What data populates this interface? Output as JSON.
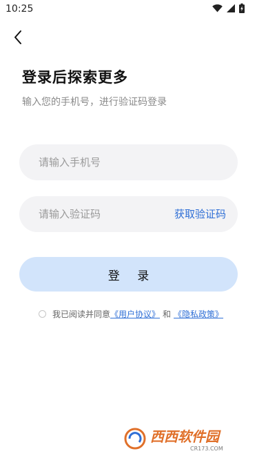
{
  "status_bar": {
    "time": "10:25",
    "icons": [
      "wifi-icon",
      "cellular-signal-icon",
      "battery-icon"
    ]
  },
  "header": {
    "back_icon": "chevron-left-icon"
  },
  "main": {
    "title": "登录后探索更多",
    "subtitle": "输入您的手机号，进行验证码登录",
    "phone_input": {
      "placeholder": "请输入手机号",
      "value": ""
    },
    "code_input": {
      "placeholder": "请输入验证码",
      "value": ""
    },
    "get_code_label": "获取验证码",
    "login_label": "登 录"
  },
  "agreement": {
    "prefix": "我已阅读并同意",
    "user_agreement": "《用户协议》",
    "and": "和",
    "privacy_policy": "《隐私政策》"
  },
  "watermark": {
    "text": "西西软件园",
    "domain": "CR173.COM"
  },
  "colors": {
    "accent": "#2f6fd6",
    "input_bg": "#f3f3f5",
    "button_bg": "#d2e4fb",
    "watermark_brand": "#e0702a"
  }
}
